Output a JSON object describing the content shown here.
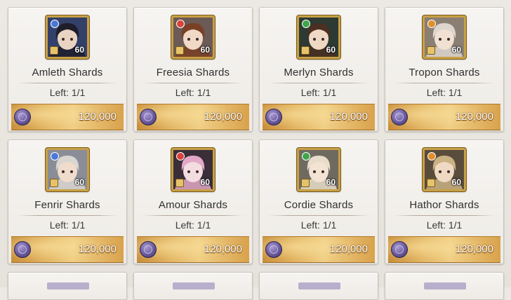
{
  "currency": {
    "icon": "purple-coin-icon"
  },
  "cards": [
    {
      "name": "Amleth Shards",
      "left": "Left: 1/1",
      "price": "120,000",
      "level": "60",
      "element_color": "#4a78d8",
      "hair": "#1f1d2a",
      "skin": "#e9d4c2",
      "bg": "#33406a"
    },
    {
      "name": "Freesia Shards",
      "left": "Left: 1/1",
      "price": "120,000",
      "level": "60",
      "element_color": "#d8443a",
      "hair": "#7a4026",
      "skin": "#f0d9c6",
      "bg": "#6b5a55"
    },
    {
      "name": "Merlyn Shards",
      "left": "Left: 1/1",
      "price": "120,000",
      "level": "60",
      "element_color": "#3fa64c",
      "hair": "#4a2f22",
      "skin": "#efd8c4",
      "bg": "#2d3a33"
    },
    {
      "name": "Tropon Shards",
      "left": "Left: 1/1",
      "price": "120,000",
      "level": "60",
      "element_color": "#e0902a",
      "hair": "#ddd6cf",
      "skin": "#f1e1d2",
      "bg": "#8b7f74"
    },
    {
      "name": "Fenrir Shards",
      "left": "Left: 1/1",
      "price": "120,000",
      "level": "60",
      "element_color": "#4a78d8",
      "hair": "#d9d6d2",
      "skin": "#f0dccb",
      "bg": "#8a8d96"
    },
    {
      "name": "Amour Shards",
      "left": "Left: 1/1",
      "price": "120,000",
      "level": "60",
      "element_color": "#d8443a",
      "hair": "#e3a8c8",
      "skin": "#f4dde0",
      "bg": "#3a2e38"
    },
    {
      "name": "Cordie Shards",
      "left": "Left: 1/1",
      "price": "120,000",
      "level": "60",
      "element_color": "#3fa64c",
      "hair": "#e7ddc9",
      "skin": "#f3e3d3",
      "bg": "#6f6a60"
    },
    {
      "name": "Hathor Shards",
      "left": "Left: 1/1",
      "price": "120,000",
      "level": "60",
      "element_color": "#e0902a",
      "hair": "#c9b183",
      "skin": "#efd9c3",
      "bg": "#5a4c3c"
    }
  ]
}
